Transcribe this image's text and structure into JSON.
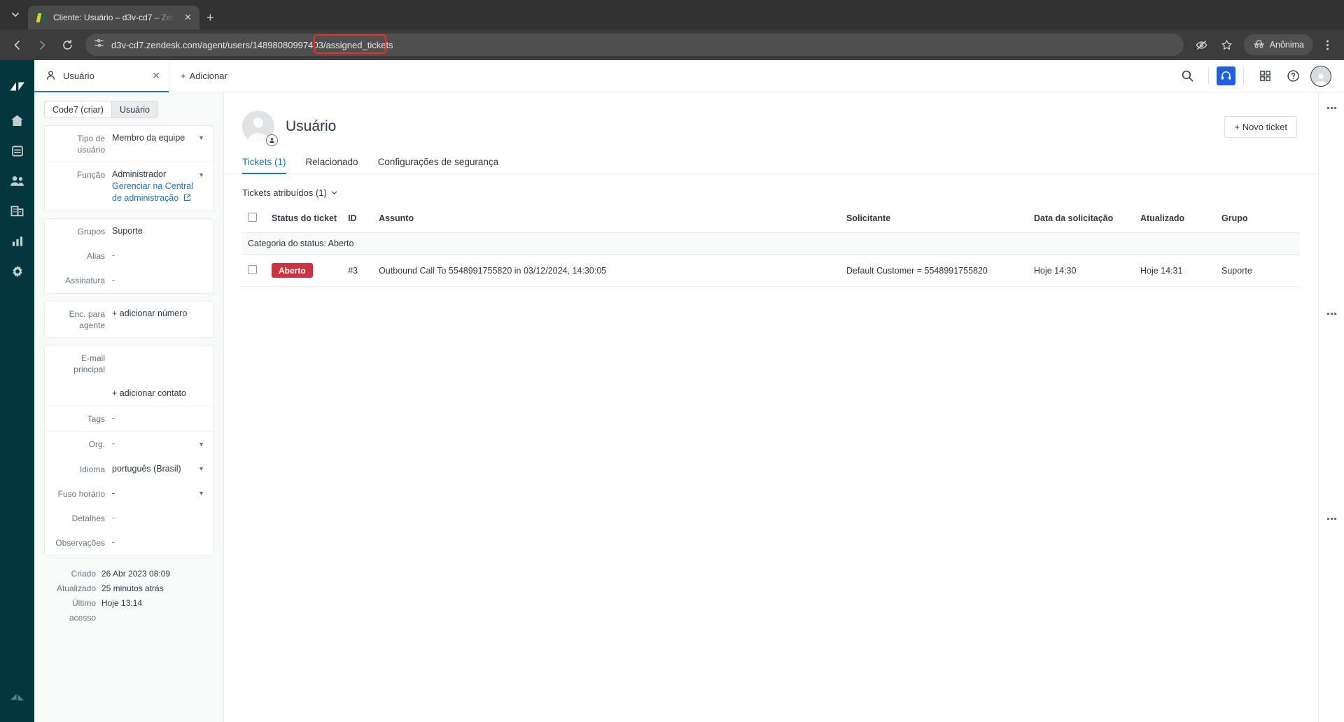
{
  "browser": {
    "tab_title": "Cliente: Usuário – d3v-cd7 – Zen",
    "new_tab_label": "+",
    "url": "d3v-cd7.zendesk.com/agent/users/14898080997403/assigned_tickets",
    "incognito_label": "Anônima",
    "highlight_color": "#ff2a1f"
  },
  "rail": {
    "items": [
      {
        "name": "zendesk-logo",
        "label": "Zendesk"
      },
      {
        "name": "home",
        "label": "Início"
      },
      {
        "name": "views",
        "label": "Visualizações"
      },
      {
        "name": "customers",
        "label": "Clientes"
      },
      {
        "name": "organizations",
        "label": "Organizações"
      },
      {
        "name": "reporting",
        "label": "Relatórios"
      },
      {
        "name": "admin",
        "label": "Administração"
      }
    ]
  },
  "topbar": {
    "tab_label": "Usuário",
    "tab_close": "✕",
    "add_label": "Adicionar",
    "add_plus": "+",
    "icons": [
      "search-icon",
      "talk-headset-icon",
      "apps-grid-icon",
      "help-icon",
      "avatar"
    ]
  },
  "userpanel": {
    "segments": [
      {
        "label": "Code7 (criar)",
        "active": false
      },
      {
        "label": "Usuário",
        "active": true
      }
    ],
    "fields": [
      {
        "label": "Tipo de usuário",
        "value": "Membro da equipe",
        "muted": true,
        "dropdown": true
      },
      {
        "label": "Função",
        "value": "Administrador",
        "muted": true,
        "dropdown": true
      },
      {
        "label": "Grupos",
        "value": "Suporte",
        "muted": false,
        "dropdown": false
      },
      {
        "label": "Alias",
        "value": "-",
        "muted": false,
        "dropdown": false
      },
      {
        "label": "Assinatura",
        "value": "-",
        "muted": false,
        "dropdown": false
      },
      {
        "label": "Enc. para agente",
        "value": "+ adicionar número",
        "muted": false,
        "dropdown": false
      },
      {
        "label": "E-mail principal",
        "value": "",
        "muted": false,
        "dropdown": false
      },
      {
        "label": "Tags",
        "value": "-",
        "muted": false,
        "dropdown": false
      },
      {
        "label": "Org.",
        "value": "-",
        "muted": false,
        "dropdown": true
      },
      {
        "label": "Idioma",
        "value": "português (Brasil)",
        "muted": false,
        "dropdown": true
      },
      {
        "label": "Fuso horário",
        "value": "-",
        "muted": false,
        "dropdown": true
      },
      {
        "label": "Detalhes",
        "value": "-",
        "muted": false,
        "dropdown": false
      },
      {
        "label": "Observações",
        "value": "-",
        "muted": false,
        "dropdown": false
      }
    ],
    "manage_admin_link": "Gerenciar na Central de administração",
    "add_number_label": "+ adicionar número",
    "add_contact_label": "+ adicionar contato",
    "meta": [
      {
        "label": "Criado",
        "value": "26 Abr 2023 08:09"
      },
      {
        "label": "Atualizado",
        "value": "25 minutos atrás"
      },
      {
        "label": "Último acesso",
        "value": "Hoje 13:14"
      }
    ]
  },
  "main": {
    "user_name": "Usuário",
    "new_ticket_label": "+ Novo ticket",
    "tabs": [
      {
        "label": "Tickets (1)",
        "active": true
      },
      {
        "label": "Relacionado",
        "active": false
      },
      {
        "label": "Configurações de segurança",
        "active": false
      }
    ],
    "list_title": "Tickets atribuídos (1)",
    "group_row_label": "Categoria do status: Aberto",
    "columns": [
      "Status do ticket",
      "ID",
      "Assunto",
      "Solicitante",
      "Data da solicitação",
      "Atualizado",
      "Grupo"
    ],
    "rows": [
      {
        "status": "Aberto",
        "status_color": "#cc3340",
        "id": "#3",
        "subject": "Outbound Call To 5548991755820 in 03/12/2024, 14:30:05",
        "requester": "Default Customer = 5548991755820",
        "request_date": "Hoje 14:30",
        "updated": "Hoje 14:31",
        "group": "Suporte"
      }
    ]
  }
}
